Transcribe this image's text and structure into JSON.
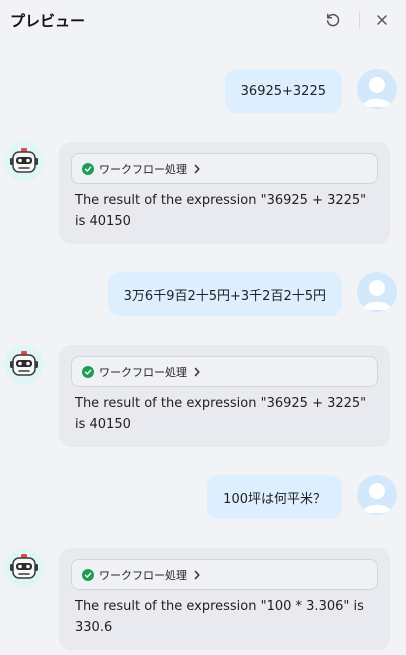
{
  "header": {
    "title": "プレビュー"
  },
  "messages": [
    {
      "role": "user",
      "text": "36925+3225"
    },
    {
      "role": "assistant",
      "workflow_label": "ワークフロー処理",
      "answer": "The result of the expression \"36925 + 3225\" is 40150"
    },
    {
      "role": "user",
      "text": "3万6千9百2十5円+3千2百2十5円"
    },
    {
      "role": "assistant",
      "workflow_label": "ワークフロー処理",
      "answer": "The result of the expression \"36925 + 3225\" is 40150"
    },
    {
      "role": "user",
      "text": "100坪は何平米？"
    },
    {
      "role": "assistant",
      "workflow_label": "ワークフロー処理",
      "answer": "The result of the expression \"100 * 3.306\" is 330.6"
    }
  ],
  "colors": {
    "background": "#f2f3f7",
    "user_bubble": "#ddeefe",
    "bot_bubble": "#e9eaef",
    "success": "#1f9d55"
  },
  "icons": {
    "refresh": "refresh-icon",
    "close": "close-icon",
    "check": "check-circle-icon",
    "chevron": "chevron-right-icon",
    "user_avatar": "user-avatar-icon",
    "bot_avatar": "robot-avatar-icon"
  }
}
